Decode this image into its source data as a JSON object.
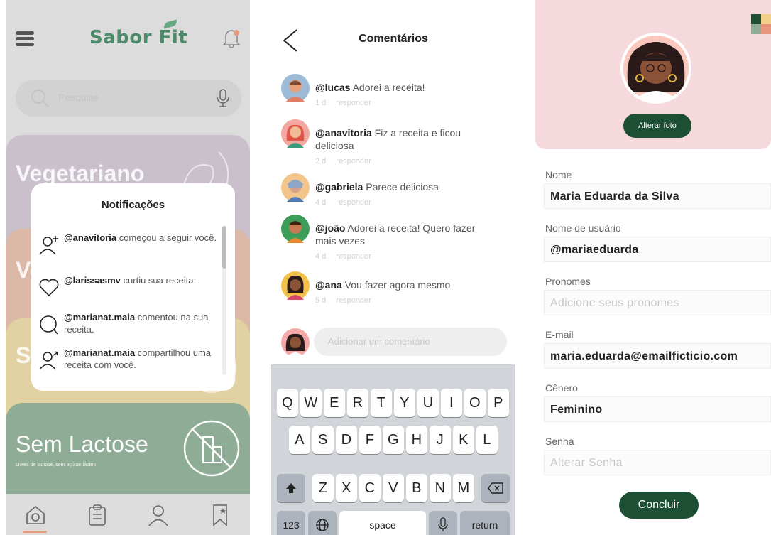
{
  "home": {
    "logo": "Sabor Fit",
    "search": {
      "placeholder": "Pesquise"
    },
    "categories": [
      {
        "title": "Vegetariano",
        "subtitle": ""
      },
      {
        "title": "Ve",
        "subtitle": ""
      },
      {
        "title": "S",
        "subtitle": ""
      },
      {
        "title": "Sem Lactose",
        "subtitle": "Livres de lactose, sem açúcar lácteo"
      }
    ],
    "notifications": {
      "title": "Notificações",
      "items": [
        {
          "user": "@anavitoria",
          "text": " começou a seguir você.",
          "icon": "follow-icon"
        },
        {
          "user": "@larissasmv",
          "text": " curtiu sua receita.",
          "icon": "heart-icon"
        },
        {
          "user": "@marianat.maia",
          "text": " comentou na sua receita.",
          "icon": "comment-icon"
        },
        {
          "user": "@marianat.maia",
          "text": " compartilhou uma receita com você.",
          "icon": "share-user-icon"
        }
      ]
    },
    "nav": [
      "home-icon",
      "list-icon",
      "profile-icon",
      "bookmark-icon"
    ]
  },
  "comments": {
    "title": "Comentários",
    "items": [
      {
        "user": "@lucas",
        "text": " Adorei a receita!",
        "time": "1 d",
        "reply": "responder"
      },
      {
        "user": "@anavitoria",
        "text": " Fiz a receita e ficou deliciosa",
        "time": "2 d",
        "reply": "responder"
      },
      {
        "user": "@gabriela",
        "text": " Parece deliciosa",
        "time": "4 d",
        "reply": "responder"
      },
      {
        "user": "@joão",
        "text": " Adorei a receita! Quero fazer mais vezes",
        "time": "4 d",
        "reply": "responder"
      },
      {
        "user": "@ana",
        "text": " Vou fazer agora mesmo",
        "time": "5 d",
        "reply": "responder"
      }
    ],
    "add_placeholder": "Adicionar um comentário",
    "keyboard": {
      "row1": [
        "Q",
        "W",
        "E",
        "R",
        "T",
        "Y",
        "U",
        "I",
        "O",
        "P"
      ],
      "row2": [
        "A",
        "S",
        "D",
        "F",
        "G",
        "H",
        "J",
        "K",
        "L"
      ],
      "row3": [
        "Z",
        "X",
        "C",
        "V",
        "B",
        "N",
        "M"
      ],
      "num": "123",
      "space": "space",
      "return": "return"
    }
  },
  "profile": {
    "change_photo": "Alterar foto",
    "fields": [
      {
        "label": "Nome",
        "value": "Maria Eduarda da Silva",
        "placeholder": false
      },
      {
        "label": "Nome de usuário",
        "value": "@mariaeduarda",
        "placeholder": false
      },
      {
        "label": "Pronomes",
        "value": "Adicione seus pronomes",
        "placeholder": true
      },
      {
        "label": "E-mail",
        "value": "maria.eduarda@emailficticio.com",
        "placeholder": false
      },
      {
        "label": "Cênero",
        "value": "Feminino",
        "placeholder": false
      },
      {
        "label": "Senha",
        "value": "Alterar Senha",
        "placeholder": true
      }
    ],
    "submit": "Concluir"
  },
  "colors": {
    "brand_green": "#1d4f35",
    "logo_green": "#4c8a6a",
    "profile_bg": "#f6d9dc"
  }
}
